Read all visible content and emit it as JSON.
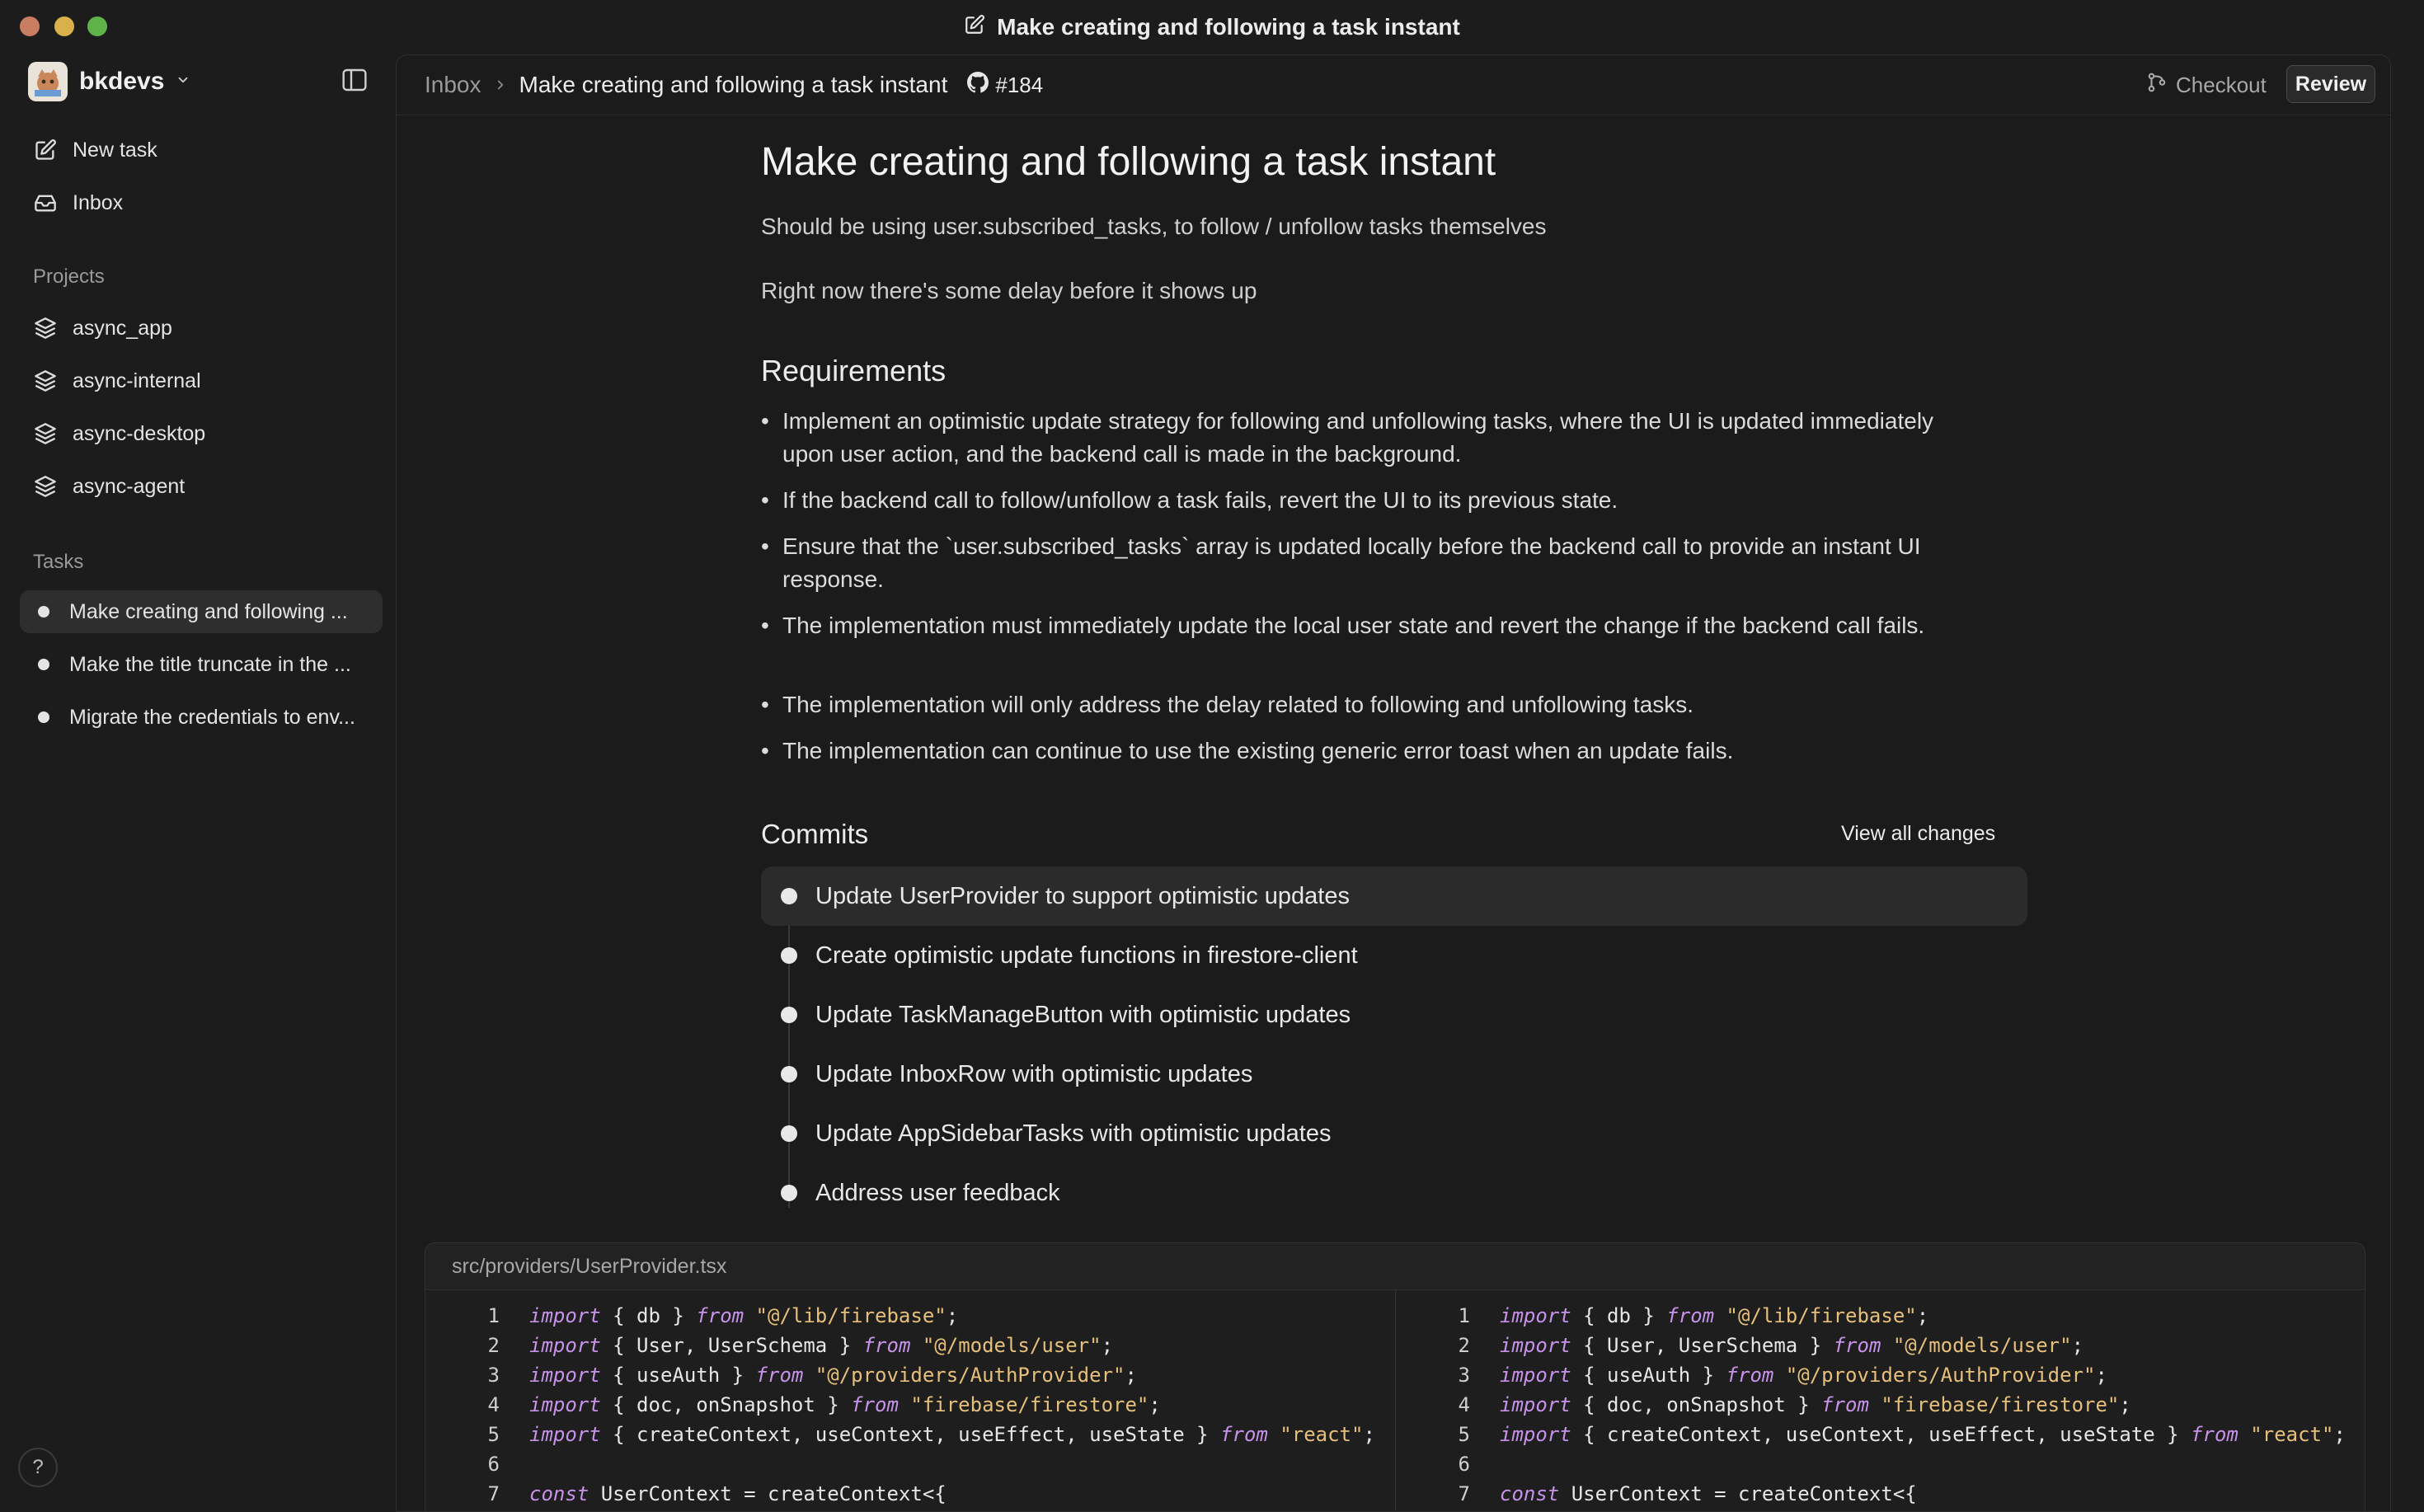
{
  "window": {
    "title": "Make creating and following a task instant",
    "traffic_colors": [
      "#c97d63",
      "#d8b14b",
      "#5fb349"
    ]
  },
  "sidebar": {
    "workspace_name": "bkdevs",
    "nav": [
      {
        "label": "New task",
        "icon": "edit-icon"
      },
      {
        "label": "Inbox",
        "icon": "inbox-icon"
      }
    ],
    "projects_label": "Projects",
    "projects": [
      {
        "label": "async_app",
        "icon": "layers-icon"
      },
      {
        "label": "async-internal",
        "icon": "layers-icon"
      },
      {
        "label": "async-desktop",
        "icon": "layers-icon"
      },
      {
        "label": "async-agent",
        "icon": "layers-icon"
      }
    ],
    "tasks_label": "Tasks",
    "tasks": [
      {
        "label": "Make creating and following ...",
        "active": true
      },
      {
        "label": "Make the title truncate in the ...",
        "active": false
      },
      {
        "label": "Migrate the credentials to env...",
        "active": false
      }
    ],
    "help_label": "?"
  },
  "header": {
    "breadcrumb_root": "Inbox",
    "breadcrumb_title": "Make creating and following a task instant",
    "issue_number": "#184",
    "checkout_label": "Checkout",
    "review_label": "Review"
  },
  "task": {
    "title": "Make creating and following a task instant",
    "description": [
      "Should be using user.subscribed_tasks, to follow / unfollow tasks themselves",
      "Right now there's some delay before it shows up"
    ],
    "requirements_heading": "Requirements",
    "requirements": [
      "Implement an optimistic update strategy for following and unfollowing tasks, where the UI is updated immediately upon user action, and the backend call is made in the background.",
      "If the backend call to follow/unfollow a task fails, revert the UI to its previous state.",
      "Ensure that the `user.subscribed_tasks` array is updated locally before the backend call to provide an instant UI response.",
      "The implementation must immediately update the local user state and revert the change if the backend call fails.",
      "The implementation will only address the delay related to following and unfollowing tasks.",
      "The implementation can continue to use the existing generic error toast when an update fails."
    ]
  },
  "commits": {
    "heading": "Commits",
    "view_all_label": "View all changes",
    "items": [
      "Update UserProvider to support optimistic updates",
      "Create optimistic update functions in firestore-client",
      "Update TaskManageButton with optimistic updates",
      "Update InboxRow with optimistic updates",
      "Update AppSidebarTasks with optimistic updates",
      "Address user feedback"
    ]
  },
  "diff": {
    "file_path": "src/providers/UserProvider.tsx",
    "left": [
      {
        "n": "1",
        "tokens": [
          [
            "kw",
            "import"
          ],
          [
            "pl",
            " { db } "
          ],
          [
            "kw",
            "from"
          ],
          [
            "str",
            " \"@/lib/firebase\""
          ],
          [
            "pl",
            ";"
          ]
        ]
      },
      {
        "n": "2",
        "tokens": [
          [
            "kw",
            "import"
          ],
          [
            "pl",
            " { User, UserSchema } "
          ],
          [
            "kw",
            "from"
          ],
          [
            "str",
            " \"@/models/user\""
          ],
          [
            "pl",
            ";"
          ]
        ]
      },
      {
        "n": "3",
        "tokens": [
          [
            "kw",
            "import"
          ],
          [
            "pl",
            " { useAuth } "
          ],
          [
            "kw",
            "from"
          ],
          [
            "str",
            " \"@/providers/AuthProvider\""
          ],
          [
            "pl",
            ";"
          ]
        ]
      },
      {
        "n": "4",
        "tokens": [
          [
            "kw",
            "import"
          ],
          [
            "pl",
            " { doc, onSnapshot } "
          ],
          [
            "kw",
            "from"
          ],
          [
            "str",
            " \"firebase/firestore\""
          ],
          [
            "pl",
            ";"
          ]
        ]
      },
      {
        "n": "5",
        "tokens": [
          [
            "kw",
            "import"
          ],
          [
            "pl",
            " { createContext, useContext, useEffect, useState } "
          ],
          [
            "kw",
            "from"
          ],
          [
            "str",
            " \"react\""
          ],
          [
            "pl",
            ";"
          ]
        ]
      },
      {
        "n": "6",
        "tokens": []
      },
      {
        "n": "7",
        "tokens": [
          [
            "kw",
            "const"
          ],
          [
            "pl",
            " UserContext = createContext<{"
          ]
        ]
      }
    ],
    "right": [
      {
        "n": "1",
        "tokens": [
          [
            "kw",
            "import"
          ],
          [
            "pl",
            " { db } "
          ],
          [
            "kw",
            "from"
          ],
          [
            "str",
            " \"@/lib/firebase\""
          ],
          [
            "pl",
            ";"
          ]
        ]
      },
      {
        "n": "2",
        "tokens": [
          [
            "kw",
            "import"
          ],
          [
            "pl",
            " { User, UserSchema } "
          ],
          [
            "kw",
            "from"
          ],
          [
            "str",
            " \"@/models/user\""
          ],
          [
            "pl",
            ";"
          ]
        ]
      },
      {
        "n": "3",
        "tokens": [
          [
            "kw",
            "import"
          ],
          [
            "pl",
            " { useAuth } "
          ],
          [
            "kw",
            "from"
          ],
          [
            "str",
            " \"@/providers/AuthProvider\""
          ],
          [
            "pl",
            ";"
          ]
        ]
      },
      {
        "n": "4",
        "tokens": [
          [
            "kw",
            "import"
          ],
          [
            "pl",
            " { doc, onSnapshot } "
          ],
          [
            "kw",
            "from"
          ],
          [
            "str",
            " \"firebase/firestore\""
          ],
          [
            "pl",
            ";"
          ]
        ]
      },
      {
        "n": "5",
        "tokens": [
          [
            "kw",
            "import"
          ],
          [
            "pl",
            " { createContext, useContext, useEffect, useState } "
          ],
          [
            "kw",
            "from"
          ],
          [
            "str",
            " \"react\""
          ],
          [
            "pl",
            ";"
          ]
        ]
      },
      {
        "n": "6",
        "tokens": []
      },
      {
        "n": "7",
        "tokens": [
          [
            "kw",
            "const"
          ],
          [
            "pl",
            " UserContext = createContext<{"
          ]
        ]
      }
    ]
  }
}
